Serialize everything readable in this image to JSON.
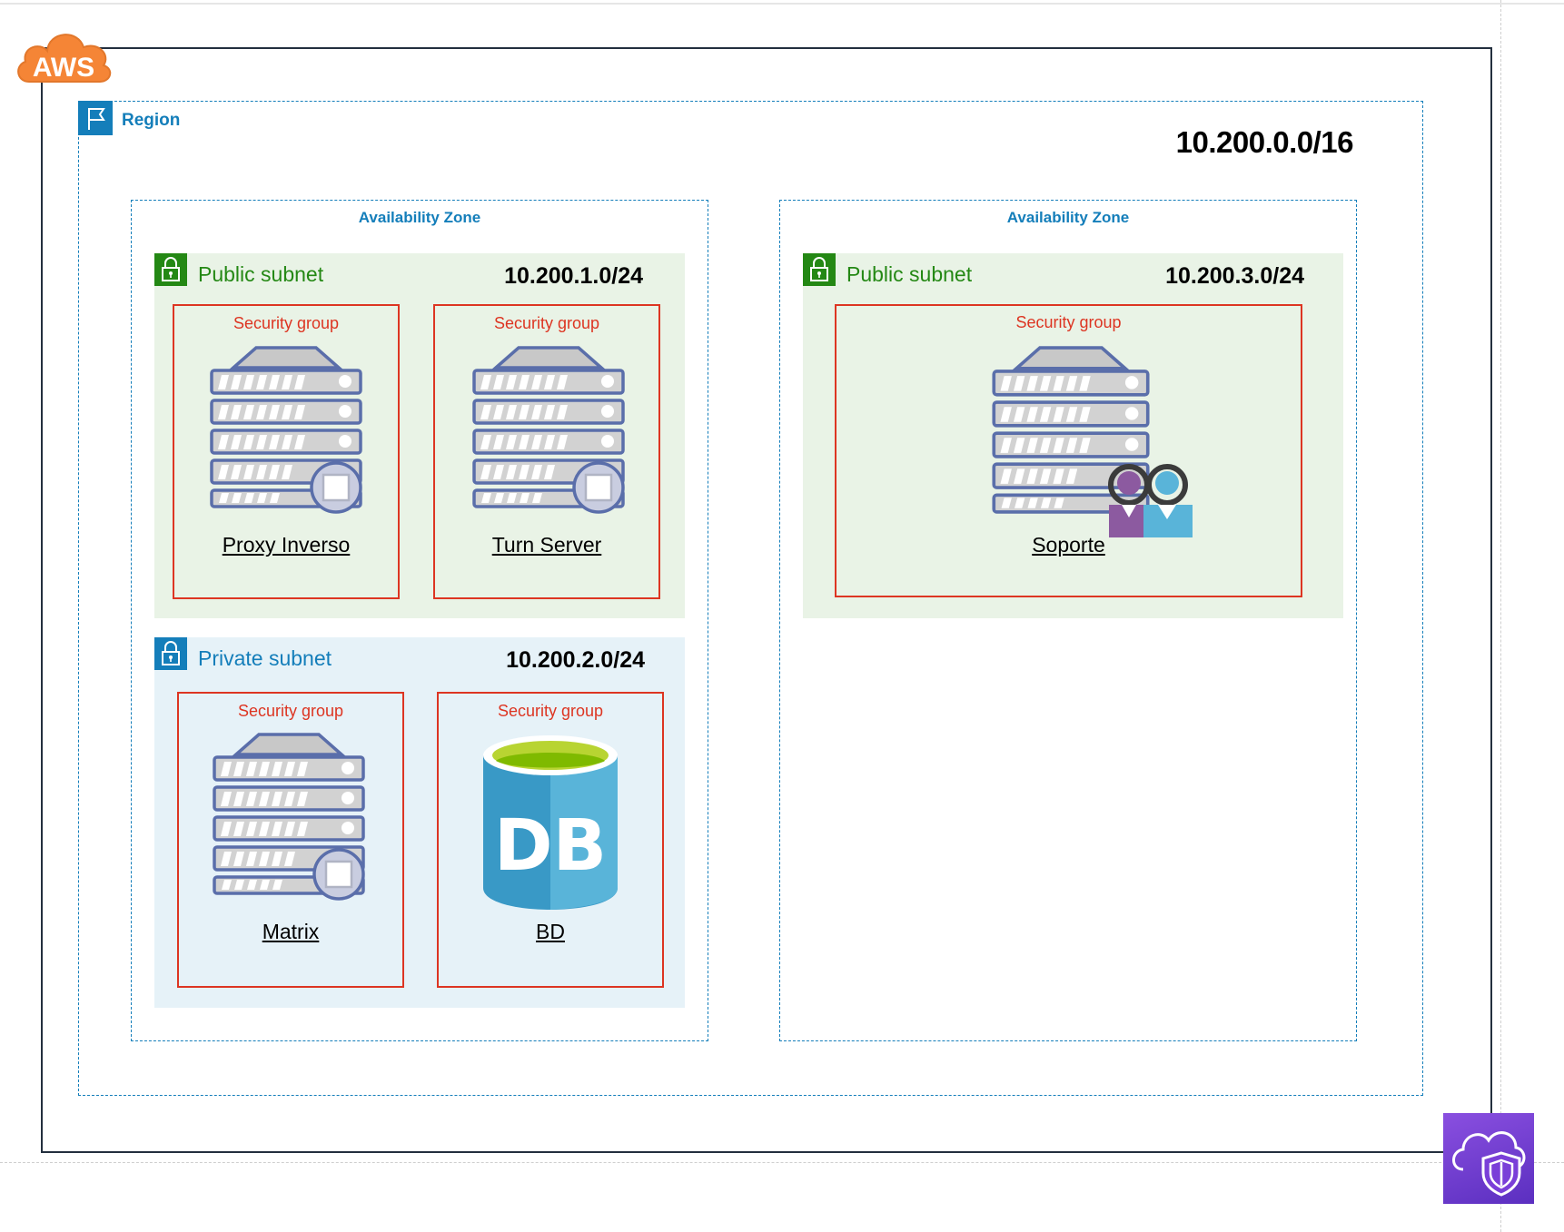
{
  "diagram": {
    "aws_logo_text": "AWS",
    "region": {
      "label": "Region",
      "cidr": "10.200.0.0/16"
    },
    "availability_zones": [
      {
        "label": "Availability Zone",
        "public_subnet": {
          "label": "Public subnet",
          "cidr": "10.200.1.0/24",
          "security_groups": [
            {
              "label": "Security group",
              "resource": "Proxy Inverso",
              "icon": "server-icon"
            },
            {
              "label": "Security group",
              "resource": "Turn Server",
              "icon": "server-icon"
            }
          ]
        },
        "private_subnet": {
          "label": "Private subnet",
          "cidr": "10.200.2.0/24",
          "security_groups": [
            {
              "label": "Security group",
              "resource": "Matrix",
              "icon": "server-icon"
            },
            {
              "label": "Security group",
              "resource": "BD",
              "icon": "database-icon",
              "icon_text": "DB"
            }
          ]
        }
      },
      {
        "label": "Availability Zone",
        "public_subnet": {
          "label": "Public subnet",
          "cidr": "10.200.3.0/24",
          "security_groups": [
            {
              "label": "Security group",
              "resource": "Soporte",
              "icon": "server-users-icon"
            }
          ]
        }
      }
    ],
    "colors": {
      "aws_orange": "#f58536",
      "region_blue": "#147eba",
      "public_green": "#248814",
      "security_red": "#dd3522",
      "public_fill": "#e9f3e6",
      "private_fill": "#e6f2f8",
      "shield_purple": "#7a3fd8"
    }
  }
}
